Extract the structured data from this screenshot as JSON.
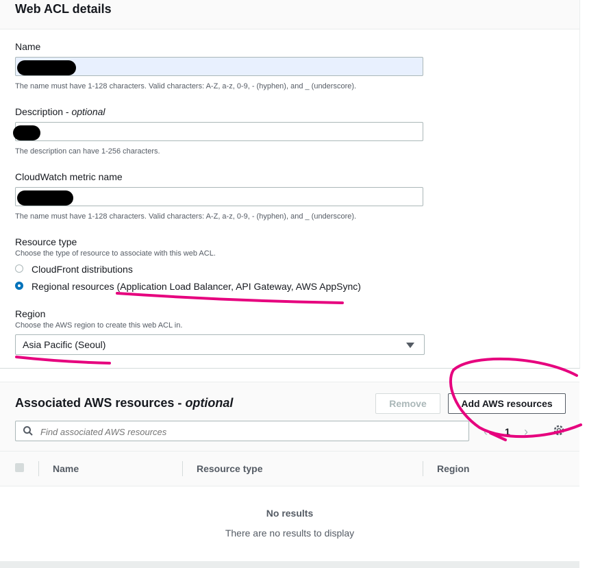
{
  "details": {
    "title": "Web ACL details",
    "name_label": "Name",
    "name_hint": "The name must have 1-128 characters. Valid characters: A-Z, a-z, 0-9, - (hyphen), and _ (underscore).",
    "description_label": "Description - ",
    "description_optional": "optional",
    "description_hint": "The description can have 1-256 characters.",
    "metric_label": "CloudWatch metric name",
    "metric_hint": "The name must have 1-128 characters. Valid characters: A-Z, a-z, 0-9, - (hyphen), and _ (underscore).",
    "resource_type_label": "Resource type",
    "resource_type_hint": "Choose the type of resource to associate with this web ACL.",
    "resource_options": [
      {
        "label": "CloudFront distributions",
        "selected": false
      },
      {
        "label": "Regional resources (Application Load Balancer, API Gateway, AWS AppSync)",
        "selected": true
      }
    ],
    "region_label": "Region",
    "region_hint": "Choose the AWS region to create this web ACL in.",
    "region_value": "Asia Pacific (Seoul)"
  },
  "associated": {
    "title": "Associated AWS resources - ",
    "title_optional": "optional",
    "remove_label": "Remove",
    "add_label": "Add AWS resources",
    "search_placeholder": "Find associated AWS resources",
    "page": "1",
    "columns": [
      "Name",
      "Resource type",
      "Region"
    ],
    "empty_title": "No results",
    "empty_message": "There are no results to display"
  },
  "icons": [
    "search-icon",
    "gear-icon",
    "chevron-left-icon",
    "chevron-right-icon",
    "caret-down-icon"
  ],
  "colors": {
    "annotation": "#e6007e",
    "accent": "#0073bb"
  }
}
